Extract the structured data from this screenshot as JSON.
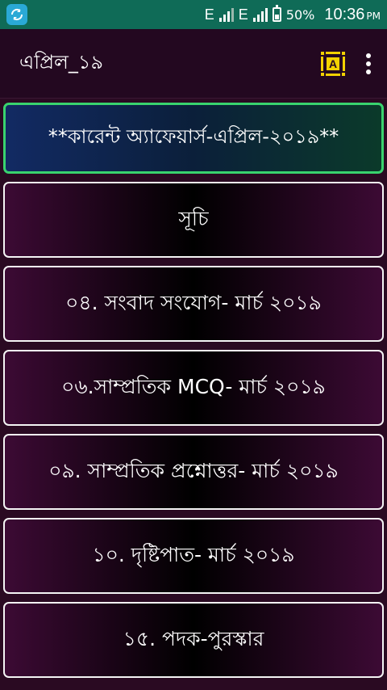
{
  "status": {
    "network1": "E",
    "network2": "E",
    "battery": "50%",
    "battery_level": 0.5,
    "time": "10:36",
    "ampm": "PM",
    "app_icon": "sync-icon"
  },
  "appbar": {
    "title": "এপ্রিল_১৯",
    "font_icon": "font-size-icon",
    "menu_icon": "more-vert-icon"
  },
  "list": {
    "header": "**কারেন্ট অ্যাফেয়ার্স-এপ্রিল-২০১৯**",
    "items": [
      {
        "label": "সূচি"
      },
      {
        "label": "০৪. সংবাদ সংযোগ- মার্চ ২০১৯"
      },
      {
        "label": "০৬.সাম্প্রতিক MCQ- মার্চ ২০১৯"
      },
      {
        "label": "০৯. সাম্প্রতিক প্রশ্নোত্তর- মার্চ ২০১৯"
      },
      {
        "label": "১০. দৃষ্টিপাত- মার্চ ২০১৯"
      },
      {
        "label": "১৫. পদক-পুরস্কার"
      }
    ]
  },
  "colors": {
    "statusbar": "#0f6b57",
    "appbar": "#230820",
    "accent_yellow": "#f2d100",
    "header_border": "#39d36e"
  }
}
